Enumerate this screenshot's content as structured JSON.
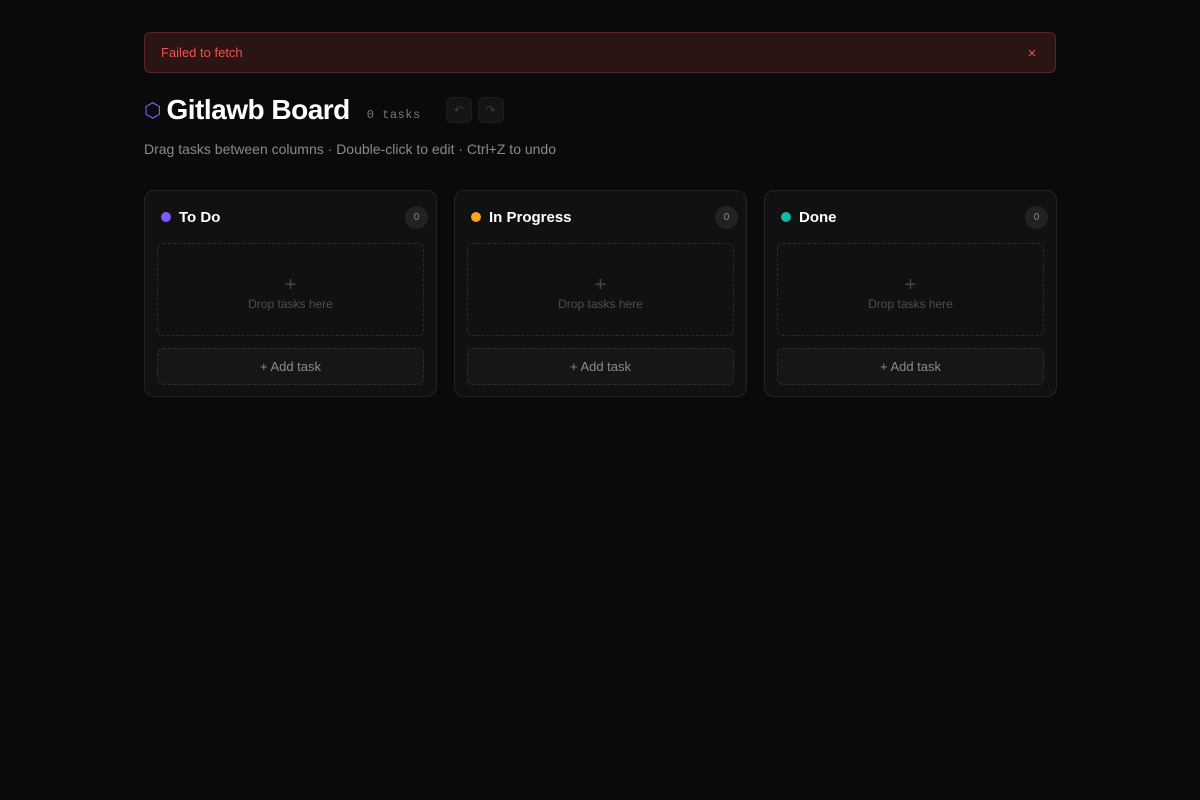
{
  "error": {
    "message": "Failed to fetch",
    "close_glyph": "×"
  },
  "header": {
    "logo_glyph": "⬡",
    "title": "Gitlawb Board",
    "task_count": "0 tasks",
    "undo_glyph": "↶",
    "redo_glyph": "↷",
    "subtitle": "Drag tasks between columns · Double-click to edit · Ctrl+Z to undo"
  },
  "columns": [
    {
      "title": "To Do",
      "count": "0",
      "color": "#7c5cff",
      "dropzone_plus": "+",
      "dropzone_text": "Drop tasks here",
      "add_label": "+ Add task"
    },
    {
      "title": "In Progress",
      "count": "0",
      "color": "#f5a524",
      "dropzone_plus": "+",
      "dropzone_text": "Drop tasks here",
      "add_label": "+ Add task"
    },
    {
      "title": "Done",
      "count": "0",
      "color": "#14b8a6",
      "dropzone_plus": "+",
      "dropzone_text": "Drop tasks here",
      "add_label": "+ Add task"
    }
  ]
}
